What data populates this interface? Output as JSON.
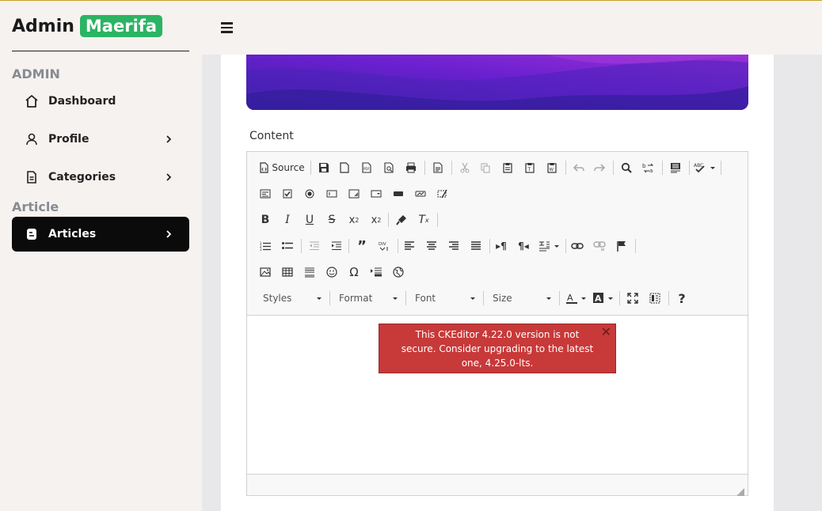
{
  "brand": {
    "admin": "Admin",
    "name": "Maerifa",
    "badge_color": "#2bb463"
  },
  "sidebar": {
    "sections": [
      {
        "label": "ADMIN"
      },
      {
        "label": "Article"
      }
    ],
    "items": [
      {
        "label": "Dashboard",
        "icon": "home-icon",
        "has_chevron": false,
        "active": false
      },
      {
        "label": "Profile",
        "icon": "user-icon",
        "has_chevron": true,
        "active": false
      },
      {
        "label": "Categories",
        "icon": "document-icon",
        "has_chevron": true,
        "active": false
      },
      {
        "label": "Articles",
        "icon": "blog-icon",
        "has_chevron": true,
        "active": true
      }
    ]
  },
  "header": {
    "menu_icon": "hamburger-icon"
  },
  "form": {
    "content_label": "Content"
  },
  "editor": {
    "source_label": "Source",
    "combos": {
      "styles": "Styles",
      "format": "Format",
      "font": "Font",
      "size": "Size"
    },
    "notice": {
      "text": "This CKEditor 4.22.0 version is not secure. Consider upgrading to the latest one, 4.25.0-lts.",
      "close": "✕",
      "color": "#c83939"
    }
  },
  "colors": {
    "sidebar_bg": "#f6f2f0",
    "active_nav": "#0b0b0b",
    "banner_from": "#3b22a8",
    "banner_to": "#8a28d9"
  }
}
